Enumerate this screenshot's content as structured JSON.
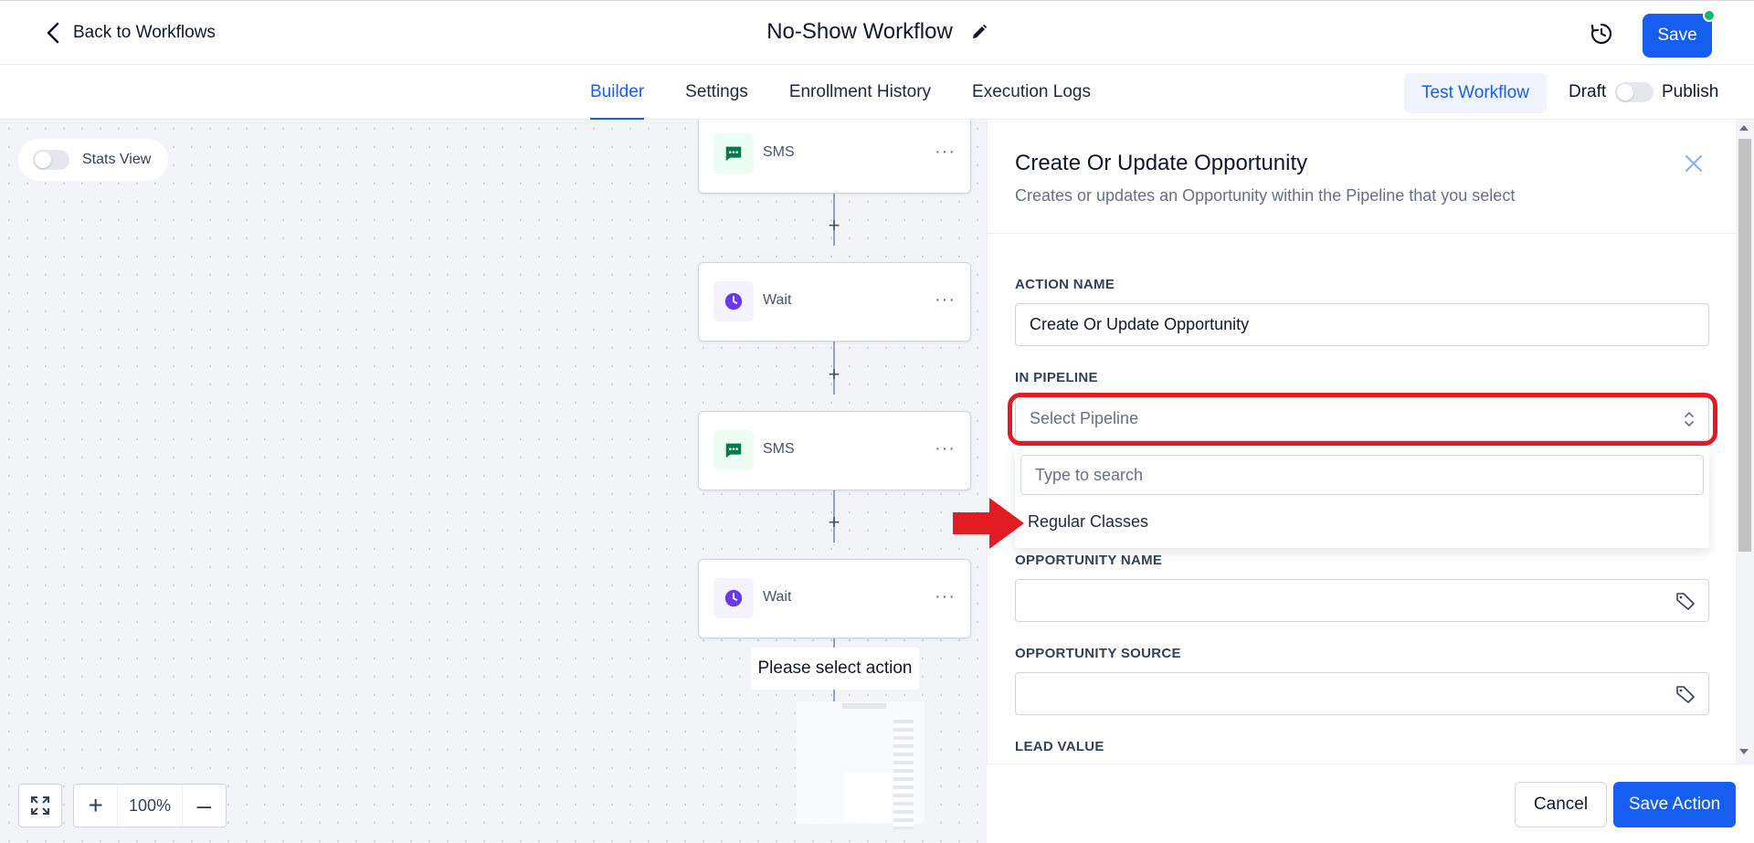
{
  "header": {
    "back_label": "Back to Workflows",
    "workflow_title": "No-Show Workflow",
    "save_label": "Save"
  },
  "tabs": [
    {
      "label": "Builder",
      "active": true
    },
    {
      "label": "Settings",
      "active": false
    },
    {
      "label": "Enrollment History",
      "active": false
    },
    {
      "label": "Execution Logs",
      "active": false
    }
  ],
  "tabbar": {
    "test_label": "Test Workflow",
    "draft_label": "Draft",
    "publish_label": "Publish"
  },
  "canvas": {
    "stats_label": "Stats View",
    "nodes": [
      {
        "label": "SMS",
        "icon": "message-icon"
      },
      {
        "label": "Wait",
        "icon": "clock-icon"
      },
      {
        "label": "SMS",
        "icon": "message-icon"
      },
      {
        "label": "Wait",
        "icon": "clock-icon"
      }
    ],
    "select_action": "Please select action",
    "zoom": "100%"
  },
  "panel": {
    "title": "Create Or Update Opportunity",
    "subtitle": "Creates or updates an Opportunity within the Pipeline that you select",
    "action_name_label": "ACTION NAME",
    "action_name_value": "Create Or Update Opportunity",
    "pipeline_label": "IN PIPELINE",
    "pipeline_placeholder": "Select Pipeline",
    "search_placeholder": "Type to search",
    "pipeline_option": "Regular Classes",
    "opp_name_label": "OPPORTUNITY NAME",
    "opp_source_label": "OPPORTUNITY SOURCE",
    "lead_value_label": "LEAD VALUE",
    "cancel_label": "Cancel",
    "save_action_label": "Save Action"
  },
  "colors": {
    "primary": "#155eef",
    "highlight": "#e31b23",
    "sms": "#027a48",
    "wait": "#6938ef"
  }
}
